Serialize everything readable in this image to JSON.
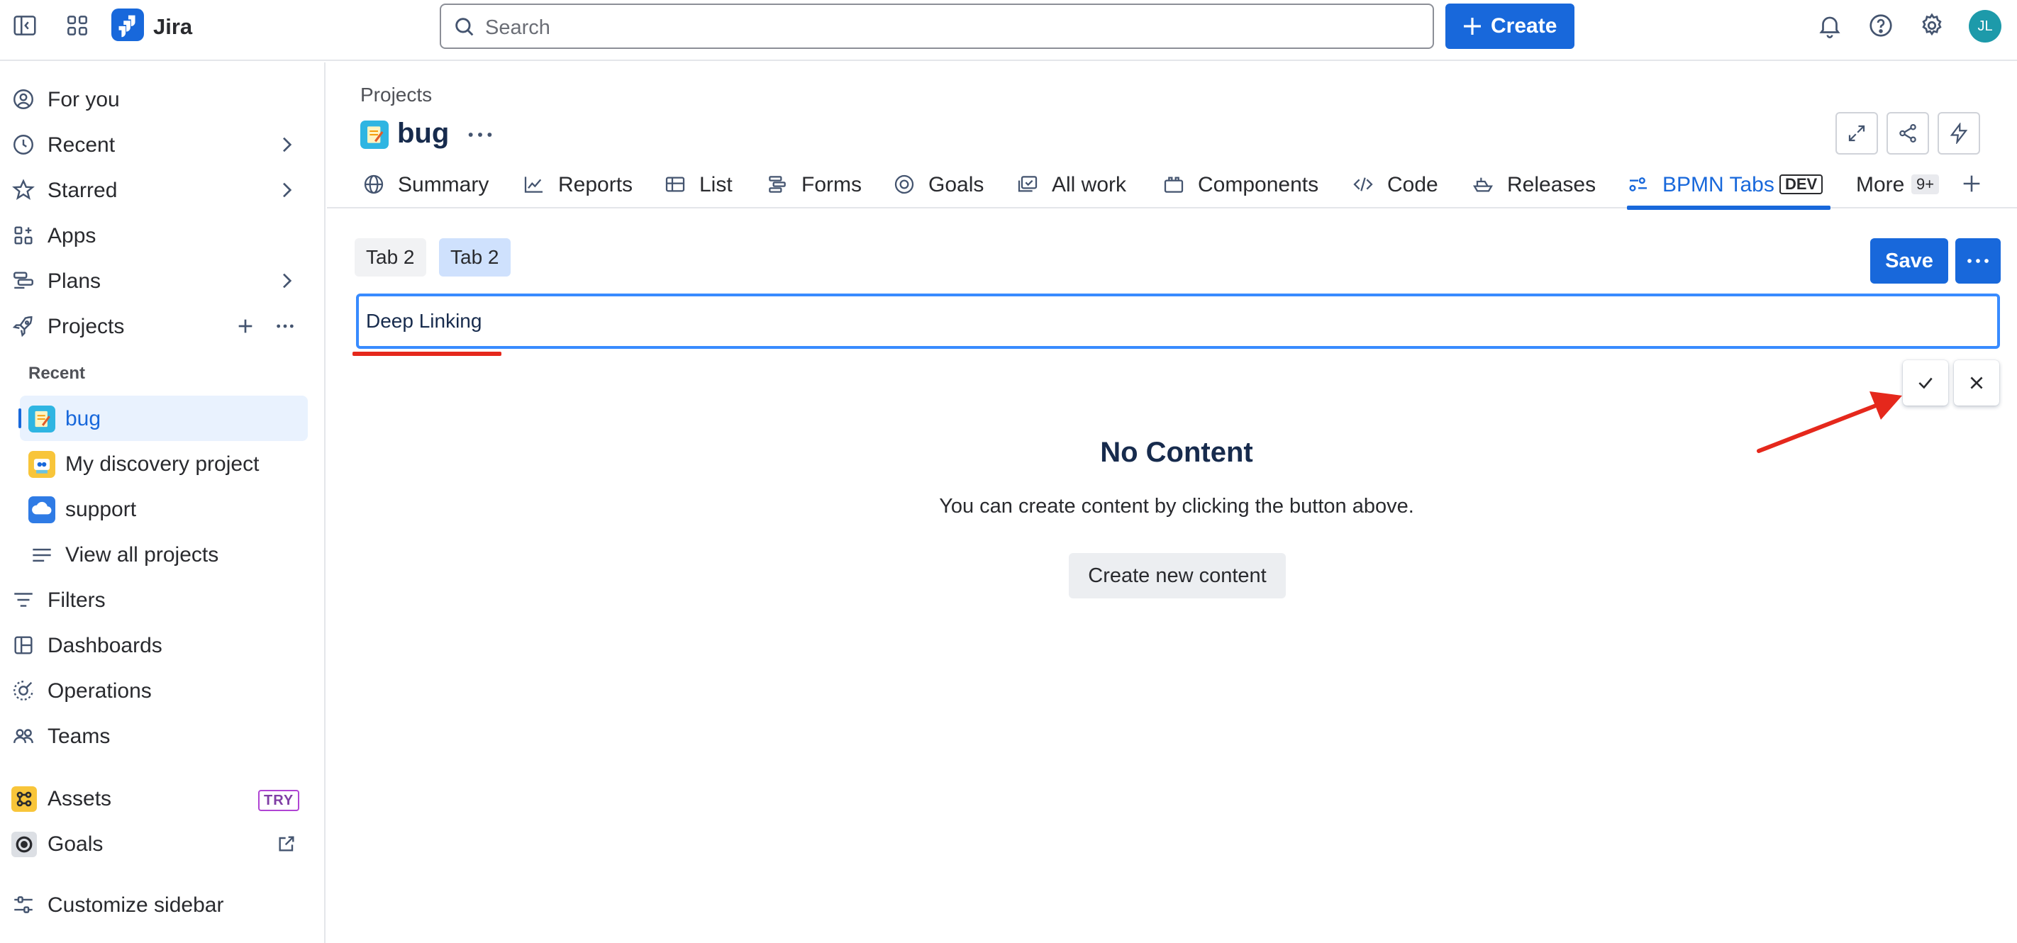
{
  "topbar": {
    "app_name": "Jira",
    "search_placeholder": "Search",
    "create_label": "Create",
    "avatar_initials": "JL",
    "icons": [
      "sidebar-toggle-icon",
      "app-switcher-icon",
      "bell-icon",
      "help-icon",
      "gear-icon"
    ]
  },
  "sidebar": {
    "items": [
      {
        "label": "For you",
        "icon": "person-circle-icon"
      },
      {
        "label": "Recent",
        "icon": "clock-icon",
        "expandable": true
      },
      {
        "label": "Starred",
        "icon": "star-icon",
        "expandable": true
      },
      {
        "label": "Apps",
        "icon": "apps-icon"
      },
      {
        "label": "Plans",
        "icon": "plans-icon",
        "expandable": true
      },
      {
        "label": "Projects",
        "icon": "rocket-icon"
      }
    ],
    "recent_label": "Recent",
    "projects": [
      {
        "label": "bug",
        "selected": true
      },
      {
        "label": "My discovery project"
      },
      {
        "label": "support"
      }
    ],
    "view_all": "View all projects",
    "lower_items": [
      {
        "label": "Filters",
        "icon": "filter-icon"
      },
      {
        "label": "Dashboards",
        "icon": "dashboard-icon"
      },
      {
        "label": "Operations",
        "icon": "operations-icon"
      },
      {
        "label": "Teams",
        "icon": "teams-icon"
      }
    ],
    "assets_label": "Assets",
    "assets_badge": "TRY",
    "goals_label": "Goals",
    "customize_label": "Customize sidebar"
  },
  "main": {
    "breadcrumb": "Projects",
    "project_title": "bug",
    "tabs": [
      {
        "label": "Summary",
        "icon": "globe-icon"
      },
      {
        "label": "Reports",
        "icon": "chart-line-icon"
      },
      {
        "label": "List",
        "icon": "list-table-icon"
      },
      {
        "label": "Forms",
        "icon": "forms-icon"
      },
      {
        "label": "Goals",
        "icon": "target-icon"
      },
      {
        "label": "All work",
        "icon": "all-work-icon"
      },
      {
        "label": "Components",
        "icon": "components-icon"
      },
      {
        "label": "Code",
        "icon": "code-icon"
      },
      {
        "label": "Releases",
        "icon": "ship-icon"
      },
      {
        "label": "BPMN Tabs",
        "icon": "bpmn-icon",
        "badge": "DEV",
        "active": true
      }
    ],
    "more_label": "More",
    "more_count": "9+",
    "inner_tabs": [
      "Tab 2",
      "Tab 2"
    ],
    "save_label": "Save",
    "tab_name_value": "Deep Linking",
    "empty_title": "No Content",
    "empty_text": "You can create content by clicking the button above.",
    "create_new_label": "Create new content"
  },
  "colors": {
    "accent": "#1868db",
    "annotation": "#e5281c",
    "focus_border": "#388bff",
    "selected_bg": "#e9f2fe"
  }
}
